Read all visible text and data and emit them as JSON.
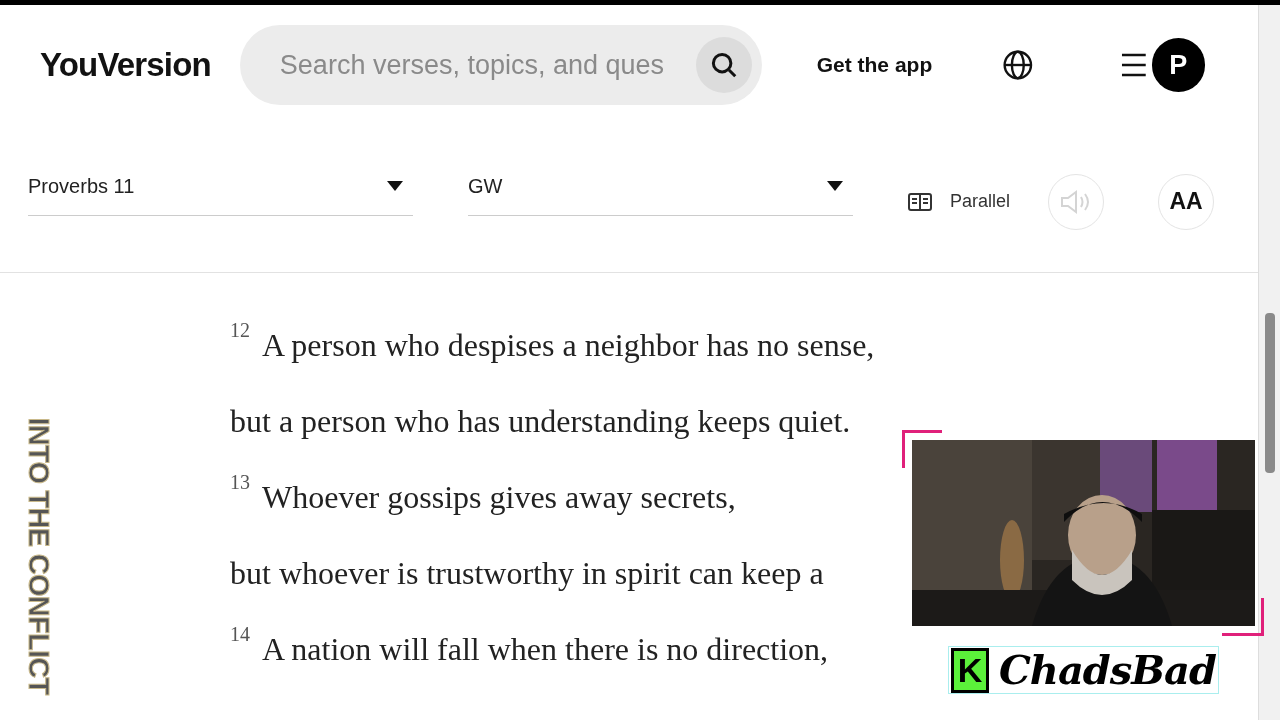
{
  "header": {
    "logo": "YouVersion",
    "search": {
      "placeholder": "Search verses, topics, and ques"
    },
    "get_app": "Get the app",
    "avatar": "P"
  },
  "toolbar": {
    "book": "Proverbs 11",
    "version": "GW",
    "parallel": "Parallel",
    "audio_disabled": true,
    "font_button": "AA"
  },
  "verses": [
    {
      "number": "12",
      "lines": [
        "A person who despises a neighbor has no sense,",
        "but a person who has understanding keeps quiet."
      ]
    },
    {
      "number": "13",
      "lines": [
        "Whoever gossips gives away secrets,",
        "but whoever is trustworthy in spirit can keep a"
      ]
    },
    {
      "number": "14",
      "lines": [
        "A nation will fall when there is no direction,"
      ]
    }
  ],
  "overlay": {
    "side_title": "INTO THE CONFLICT",
    "badge": "K",
    "brand": "ChadsBad"
  }
}
